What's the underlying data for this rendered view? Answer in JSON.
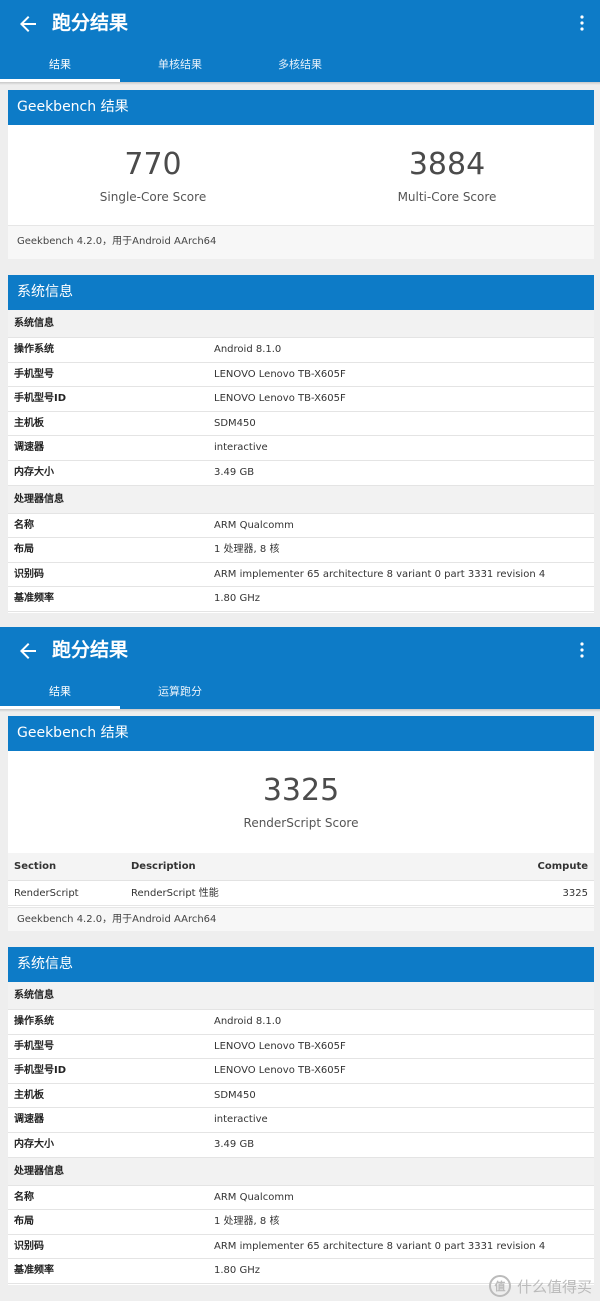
{
  "screen1": {
    "title": "跑分结果",
    "tabs": [
      "结果",
      "单核结果",
      "多核结果"
    ],
    "result_card": {
      "header": "Geekbench 结果",
      "single_core": {
        "score": "770",
        "label": "Single-Core Score"
      },
      "multi_core": {
        "score": "3884",
        "label": "Multi-Core Score"
      },
      "footnote": "Geekbench 4.2.0，用于Android AArch64"
    },
    "sys_card": {
      "header": "系统信息",
      "sections": [
        {
          "title": "系统信息",
          "rows": [
            {
              "k": "操作系统",
              "v": "Android 8.1.0"
            },
            {
              "k": "手机型号",
              "v": "LENOVO Lenovo TB-X605F"
            },
            {
              "k": "手机型号ID",
              "v": "LENOVO Lenovo TB-X605F"
            },
            {
              "k": "主机板",
              "v": "SDM450"
            },
            {
              "k": "调速器",
              "v": "interactive"
            },
            {
              "k": "内存大小",
              "v": "3.49 GB"
            }
          ]
        },
        {
          "title": "处理器信息",
          "rows": [
            {
              "k": "名称",
              "v": "ARM Qualcomm"
            },
            {
              "k": "布局",
              "v": "1 处理器, 8 核"
            },
            {
              "k": "识别码",
              "v": "ARM implementer 65 architecture 8 variant 0 part 3331 revision 4"
            },
            {
              "k": "基准频率",
              "v": "1.80 GHz"
            }
          ]
        }
      ]
    }
  },
  "screen2": {
    "title": "跑分结果",
    "tabs": [
      "结果",
      "运算跑分"
    ],
    "result_card": {
      "header": "Geekbench 结果",
      "score": "3325",
      "label": "RenderScript Score",
      "table": {
        "headers": [
          "Section",
          "Description",
          "Compute"
        ],
        "rows": [
          [
            "RenderScript",
            "RenderScript 性能",
            "3325"
          ]
        ]
      },
      "footnote": "Geekbench 4.2.0，用于Android AArch64"
    },
    "sys_card": {
      "header": "系统信息",
      "sections": [
        {
          "title": "系统信息",
          "rows": [
            {
              "k": "操作系统",
              "v": "Android 8.1.0"
            },
            {
              "k": "手机型号",
              "v": "LENOVO Lenovo TB-X605F"
            },
            {
              "k": "手机型号ID",
              "v": "LENOVO Lenovo TB-X605F"
            },
            {
              "k": "主机板",
              "v": "SDM450"
            },
            {
              "k": "调速器",
              "v": "interactive"
            },
            {
              "k": "内存大小",
              "v": "3.49 GB"
            }
          ]
        },
        {
          "title": "处理器信息",
          "rows": [
            {
              "k": "名称",
              "v": "ARM Qualcomm"
            },
            {
              "k": "布局",
              "v": "1 处理器, 8 核"
            },
            {
              "k": "识别码",
              "v": "ARM implementer 65 architecture 8 variant 0 part 3331 revision 4"
            },
            {
              "k": "基准频率",
              "v": "1.80 GHz"
            }
          ]
        }
      ]
    }
  },
  "watermark": {
    "logo": "值",
    "text": "什么值得买"
  },
  "icons": {
    "back": "arrow-back-icon",
    "more": "more-vert-icon"
  },
  "colors": {
    "primary": "#0d7bc7",
    "background": "#eeeeee"
  }
}
